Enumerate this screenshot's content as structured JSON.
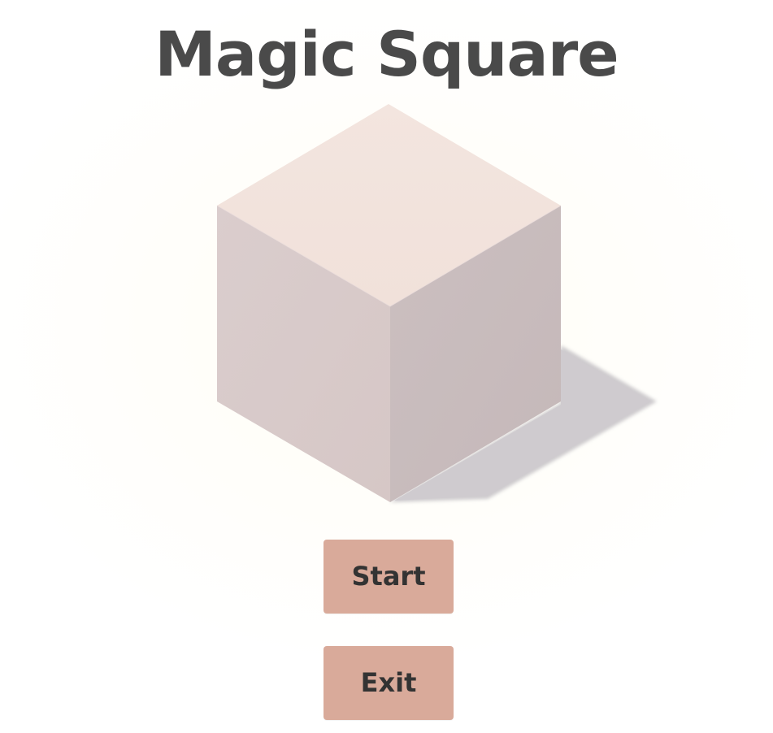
{
  "game": {
    "title": "Magic Square"
  },
  "menu": {
    "start_label": "Start",
    "exit_label": "Exit"
  },
  "colors": {
    "title_text": "#4a4a4a",
    "button_bg": "#d9aa9a",
    "button_text": "#333333",
    "cube_top": "#f2e3dc",
    "cube_left": "#d9cbcb",
    "cube_right": "#c9bcbd",
    "shadow": "#cfcccf"
  }
}
